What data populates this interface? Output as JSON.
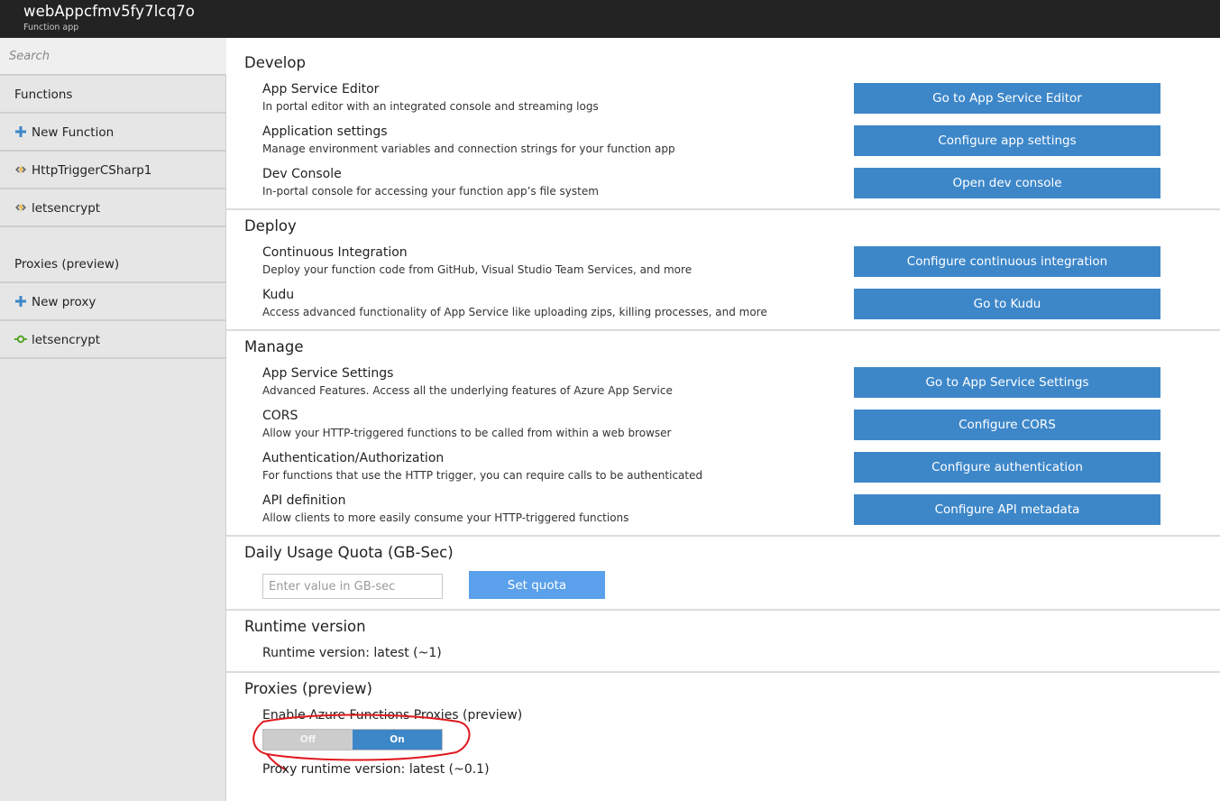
{
  "header": {
    "title": "webAppcfmv5fy7lcq7o",
    "subtitle": "Function app"
  },
  "sidebar": {
    "search_placeholder": "Search",
    "items": [
      {
        "label": "Functions",
        "icon": ""
      },
      {
        "label": "New Function",
        "icon": "plus-icon"
      },
      {
        "label": "HttpTriggerCSharp1",
        "icon": "function-bolt-icon"
      },
      {
        "label": "letsencrypt",
        "icon": "function-bolt-icon"
      },
      {
        "label": "Proxies (preview)",
        "icon": ""
      },
      {
        "label": "New proxy",
        "icon": "plus-icon"
      },
      {
        "label": "letsencrypt",
        "icon": "proxy-icon"
      }
    ]
  },
  "develop": {
    "title": "Develop",
    "items": [
      {
        "title": "App Service Editor",
        "desc": "In portal editor with an integrated console and streaming logs",
        "button": "Go to App Service Editor"
      },
      {
        "title": "Application settings",
        "desc": "Manage environment variables and connection strings for your function app",
        "button": "Configure app settings"
      },
      {
        "title": "Dev Console",
        "desc": "In-portal console for accessing your function app’s file system",
        "button": "Open dev console"
      }
    ]
  },
  "deploy": {
    "title": "Deploy",
    "items": [
      {
        "title": "Continuous Integration",
        "desc": "Deploy your function code from GitHub, Visual Studio Team Services, and more",
        "button": "Configure continuous integration"
      },
      {
        "title": "Kudu",
        "desc": "Access advanced functionality of App Service like uploading zips, killing processes, and more",
        "button": "Go to Kudu"
      }
    ]
  },
  "manage": {
    "title": "Manage",
    "items": [
      {
        "title": "App Service Settings",
        "desc": "Advanced Features. Access all the underlying features of Azure App Service",
        "button": "Go to App Service Settings"
      },
      {
        "title": "CORS",
        "desc": "Allow your HTTP-triggered functions to be called from within a web browser",
        "button": "Configure CORS"
      },
      {
        "title": "Authentication/Authorization",
        "desc": "For functions that use the HTTP trigger, you can require calls to be authenticated",
        "button": "Configure authentication"
      },
      {
        "title": "API definition",
        "desc": "Allow clients to more easily consume your HTTP-triggered functions",
        "button": "Configure API metadata"
      }
    ]
  },
  "quota": {
    "title": "Daily Usage Quota (GB-Sec)",
    "input_placeholder": "Enter value in GB-sec",
    "input_value": "",
    "button": "Set quota"
  },
  "runtime": {
    "title": "Runtime version",
    "text": "Runtime version: latest (~1)"
  },
  "proxies": {
    "title": "Proxies (preview)",
    "enable_label": "Enable Azure Functions Proxies (preview)",
    "toggle_off": "Off",
    "toggle_on": "On",
    "toggle_state": "On",
    "runtime_text": "Proxy runtime version: latest (~0.1)"
  },
  "colors": {
    "topbar": "#232323",
    "sidebar": "#e6e6e6",
    "button": "#3d87c9",
    "quota_button": "#5aa0ea",
    "annotation": "#e0191e"
  }
}
